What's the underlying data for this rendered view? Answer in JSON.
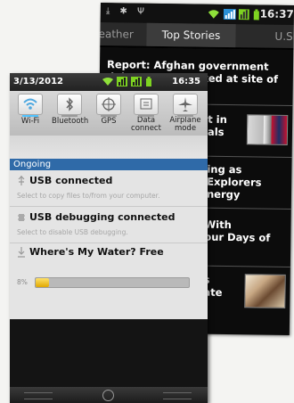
{
  "news_app": {
    "status_time": "16:37",
    "tabs": [
      "eather",
      "Top Stories",
      "U.S."
    ],
    "stories": [
      "Report: Afghan government delegation attacked at site of US",
      "t in\nals",
      "ing as Explorers\nnergy",
      "With\nour Days of",
      "s\nate"
    ]
  },
  "notification_shade": {
    "date": "3/13/2012",
    "time": "16:35",
    "toggles": [
      {
        "label": "Wi-Fi",
        "on": true
      },
      {
        "label": "Bluetooth",
        "on": false
      },
      {
        "label": "GPS",
        "on": false
      },
      {
        "label": "Data\nconnect",
        "on": false
      },
      {
        "label": "Airplane\nmode",
        "on": false
      }
    ],
    "section_header": "Ongoing",
    "notifications": [
      {
        "title": "USB connected",
        "subtitle": "Select to copy files to/from your computer."
      },
      {
        "title": "USB debugging connected",
        "subtitle": "Select to disable USB debugging."
      },
      {
        "title": "Where's My Water? Free",
        "progress_label": "8%",
        "progress": 0.08
      }
    ]
  },
  "colors": {
    "accent_blue": "#2f6aa8",
    "signal_green": "#7ed321",
    "progress_yellow": "#f1c40f"
  }
}
